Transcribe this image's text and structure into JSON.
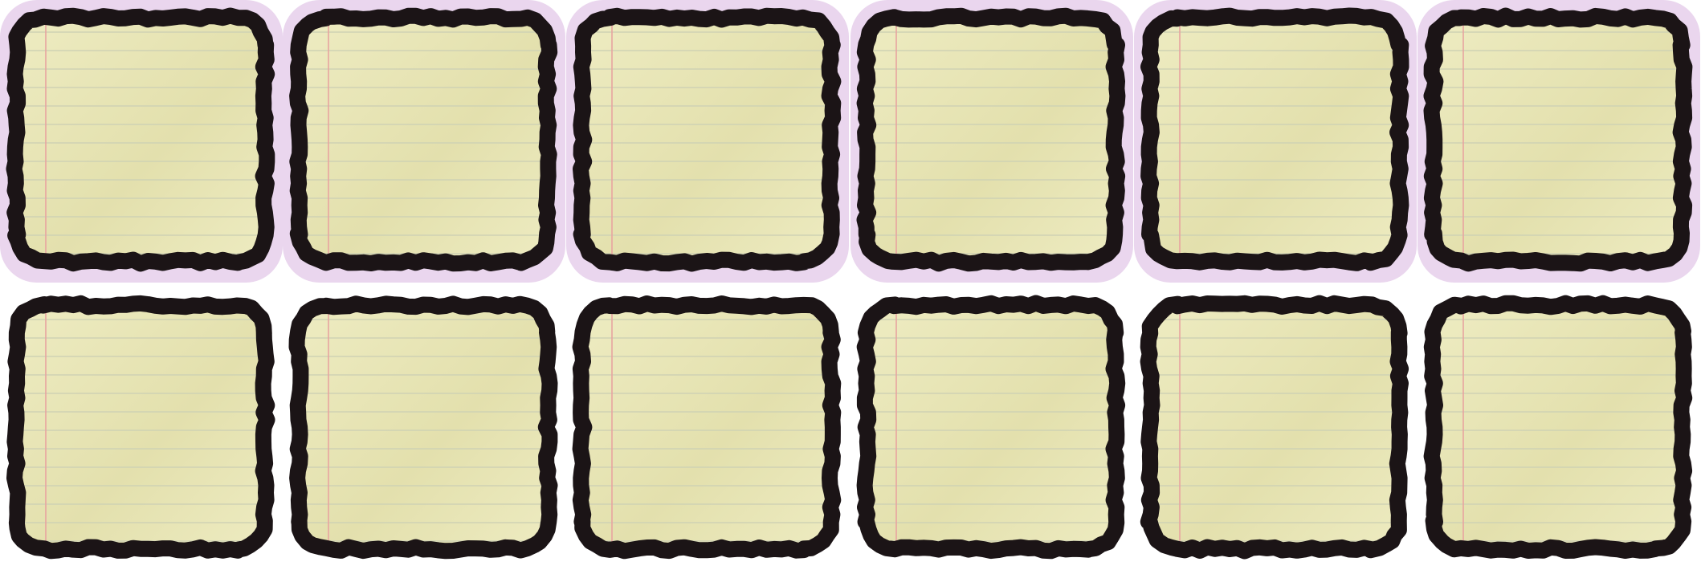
{
  "colors": {
    "selected_background": "#ead6ee",
    "paper": "#efedc4",
    "paper_shadow": "#e3e0ad",
    "rule_line": "#cfd2b4",
    "margin_line": "#e8a4a0",
    "frame": "#1b1416"
  },
  "rows": [
    {
      "selected": true,
      "tiles": [
        {
          "icon": "lined-note-paper-icon"
        },
        {
          "icon": "lined-note-paper-icon"
        },
        {
          "icon": "lined-note-paper-icon"
        },
        {
          "icon": "lined-note-paper-icon"
        },
        {
          "icon": "lined-note-paper-icon"
        },
        {
          "icon": "lined-note-paper-icon"
        }
      ]
    },
    {
      "selected": false,
      "tiles": [
        {
          "icon": "lined-note-paper-icon"
        },
        {
          "icon": "lined-note-paper-icon"
        },
        {
          "icon": "lined-note-paper-icon"
        },
        {
          "icon": "lined-note-paper-icon"
        },
        {
          "icon": "lined-note-paper-icon"
        },
        {
          "icon": "lined-note-paper-icon"
        }
      ]
    }
  ]
}
